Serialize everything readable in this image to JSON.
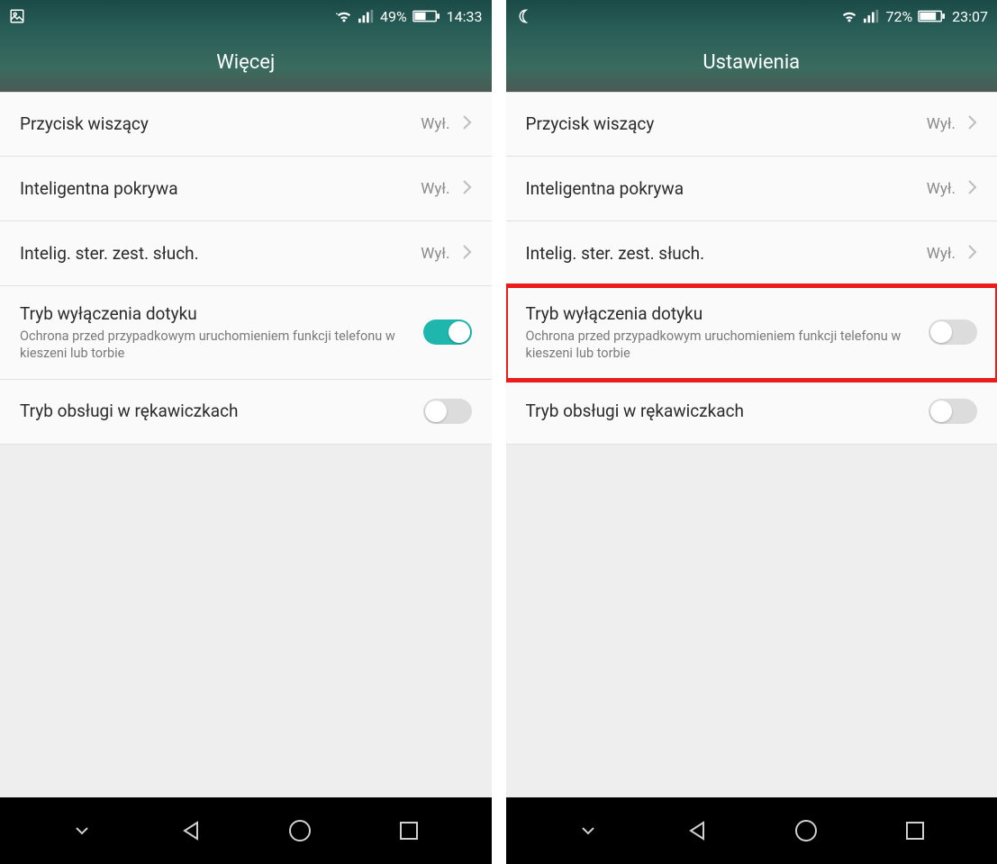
{
  "screens": [
    {
      "statusbar": {
        "left_icon": "gallery-icon",
        "battery_pct": "49%",
        "time": "14:33"
      },
      "header": {
        "title": "Więcej"
      },
      "rows": [
        {
          "title": "Przycisk wiszący",
          "value": "Wył.",
          "type": "link"
        },
        {
          "title": "Inteligentna pokrywa",
          "value": "Wył.",
          "type": "link"
        },
        {
          "title": "Intelig. ster. zest. słuch.",
          "value": "Wył.",
          "type": "link"
        },
        {
          "title": "Tryb wyłączenia dotyku",
          "sub": "Ochrona przed przypadkowym uruchomieniem funkcji telefonu w kieszeni lub torbie",
          "type": "toggle",
          "on": true,
          "highlight": false
        },
        {
          "title": "Tryb obsługi w rękawiczkach",
          "type": "toggle",
          "on": false
        }
      ]
    },
    {
      "statusbar": {
        "left_icon": "moon-icon",
        "battery_pct": "72%",
        "time": "23:07"
      },
      "header": {
        "title": "Ustawienia"
      },
      "rows": [
        {
          "title": "Przycisk wiszący",
          "value": "Wył.",
          "type": "link"
        },
        {
          "title": "Inteligentna pokrywa",
          "value": "Wył.",
          "type": "link"
        },
        {
          "title": "Intelig. ster. zest. słuch.",
          "value": "Wył.",
          "type": "link"
        },
        {
          "title": "Tryb wyłączenia dotyku",
          "sub": "Ochrona przed przypadkowym uruchomieniem funkcji telefonu w kieszeni lub torbie",
          "type": "toggle",
          "on": false,
          "highlight": true
        },
        {
          "title": "Tryb obsługi w rękawiczkach",
          "type": "toggle",
          "on": false
        }
      ]
    }
  ]
}
